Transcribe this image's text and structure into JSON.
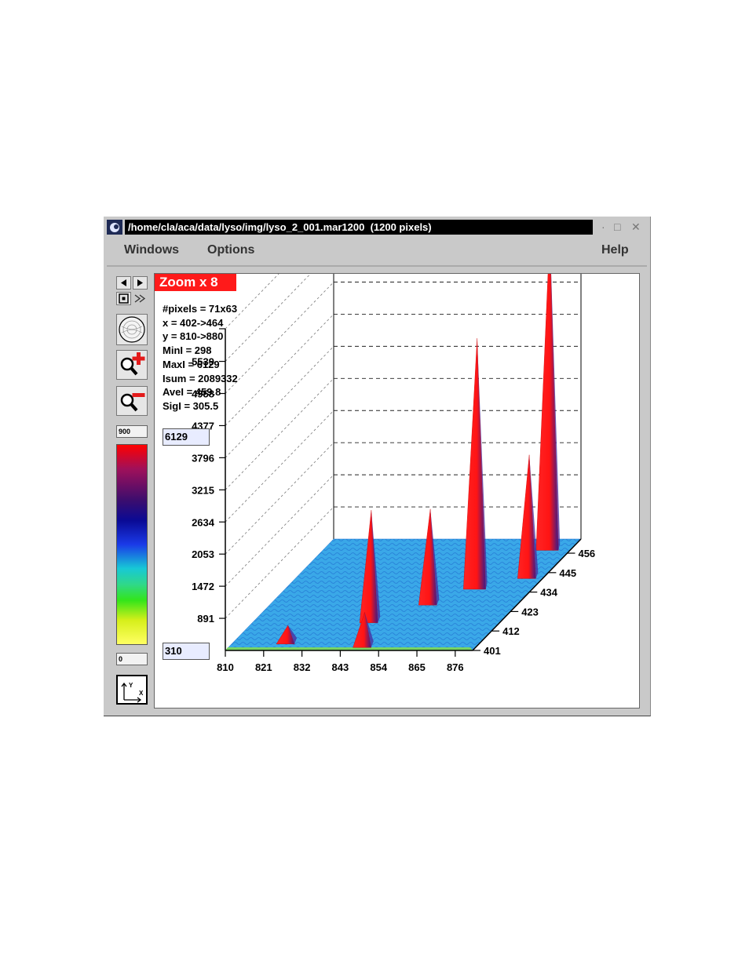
{
  "window": {
    "title": "/home/cla/aca/data/lyso/img/lyso_2_001.mar1200  (1200 pixels)",
    "controls": {
      "minimize": "·",
      "maximize": "□",
      "close": "✕"
    }
  },
  "menu": {
    "windows": "Windows",
    "options": "Options",
    "help": "Help"
  },
  "toolbar": {
    "icons": [
      "arrow-left-icon",
      "arrow-right-icon",
      "center-box-icon",
      "fast-forward-icon",
      "detector-image-icon",
      "zoom-in-icon",
      "zoom-out-icon",
      "axes-icon"
    ],
    "color_scale_max": "900",
    "color_scale_min": "0"
  },
  "view": {
    "zoom_label": "Zoom x 8",
    "stats": [
      "#pixels = 71x63",
      "x = 402->464",
      "y = 810->880",
      "MinI = 298",
      "MaxI = 6129",
      "Isum = 2089332",
      "AveI = 459.8",
      "SigI = 305.5"
    ],
    "z_max_field": "6129",
    "z_min_field": "310"
  },
  "chart_data": {
    "type": "surface",
    "z_ticks": [
      "5539",
      "4958",
      "4377",
      "3796",
      "3215",
      "2634",
      "2053",
      "1472",
      "891"
    ],
    "x_ticks": [
      "810",
      "821",
      "832",
      "843",
      "854",
      "865",
      "876"
    ],
    "y_ticks": [
      "401",
      "412",
      "423",
      "434",
      "445",
      "456"
    ],
    "z_range": [
      310,
      6129
    ],
    "peaks": [
      {
        "x": 876,
        "y": 456,
        "z": 6129
      },
      {
        "x": 866,
        "y": 434,
        "z": 4900
      },
      {
        "x": 878,
        "y": 440,
        "z": 2600
      },
      {
        "x": 845,
        "y": 415,
        "z": 2400
      },
      {
        "x": 857,
        "y": 425,
        "z": 2100
      },
      {
        "x": 827,
        "y": 403,
        "z": 700
      },
      {
        "x": 850,
        "y": 401,
        "z": 1000
      }
    ],
    "colors": {
      "peak": "#ff1a1a",
      "floor": "#3aa8e8",
      "floor_dark": "#1f6fd0",
      "low": "#7ed957"
    }
  }
}
